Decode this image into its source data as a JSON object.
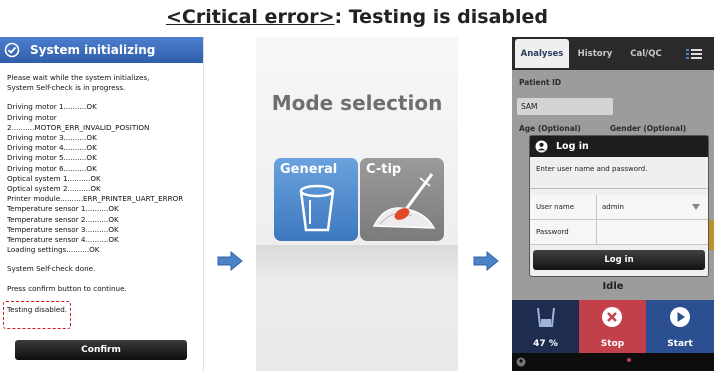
{
  "title": {
    "prefix": "<Critical error>",
    "suffix": ": Testing is disabled"
  },
  "panel1": {
    "header": "System initializing",
    "intro": [
      "Please wait while the system initializes,",
      "System Self-check is in progress."
    ],
    "checks": [
      "Driving motor 1..........OK",
      "Driving motor 2..........MOTOR_ERR_INVALID_POSITION",
      "Driving motor 3..........OK",
      "Driving motor 4..........OK",
      "Driving motor 5..........OK",
      "Driving motor 6..........OK",
      "Optical system 1..........OK",
      "Optical system 2..........OK",
      "Printer module..........ERR_PRINTER_UART_ERROR",
      "Temperature sensor 1..........OK",
      "Temperature sensor 2..........OK",
      "Temperature sensor 3..........OK",
      "Temperature sensor 4..........OK",
      "Loading settings..........OK"
    ],
    "done": "System Self-check done.",
    "press": "Press confirm button to continue.",
    "disabled": "Testing disabled.",
    "confirm": "Confirm"
  },
  "panel2": {
    "title": "Mode selection",
    "general": "General",
    "ctip": "C-tip"
  },
  "panel3": {
    "tabs": [
      "Analyses",
      "History",
      "Cal/QC"
    ],
    "patient_id_label": "Patient ID",
    "patient_id_value": "SAM",
    "age_label": "Age (Optional)",
    "gender_label": "Gender (Optional)",
    "dialog_title": "Log in",
    "dialog_message": "Enter user name and password.",
    "username_label": "User name",
    "username_value": "admin",
    "password_label": "Password",
    "login_button": "Log in",
    "status": "Idle",
    "progress_label": "47 %",
    "stop_label": "Stop",
    "start_label": "Start"
  },
  "colors": {
    "accent_blue": "#4b84c6",
    "error_red": "#d31b1b",
    "stop_red": "#c2404a"
  }
}
